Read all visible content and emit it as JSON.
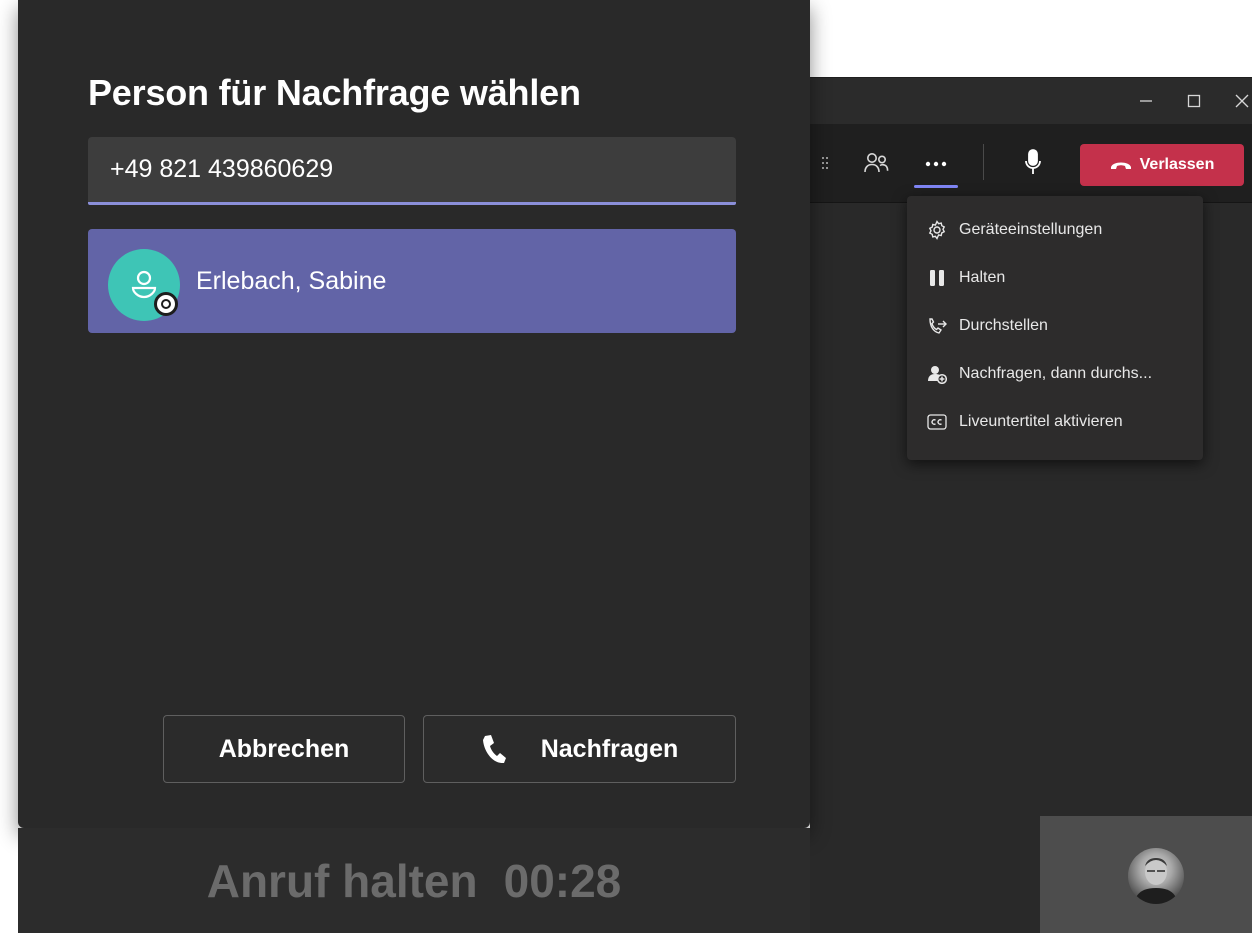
{
  "dialog": {
    "title": "Person für Nachfrage wählen",
    "search_value": "+49 821 439860629",
    "result": {
      "name": "Erlebach, Sabine",
      "presence": "offline"
    },
    "cancel_label": "Abbrechen",
    "consult_label": "Nachfragen"
  },
  "hold_status": {
    "label": "Anruf halten",
    "timer": "00:28"
  },
  "toolbar": {
    "leave_label": "Verlassen"
  },
  "more_menu": {
    "items": [
      {
        "label": "Geräteeinstellungen",
        "icon": "gear-icon"
      },
      {
        "label": "Halten",
        "icon": "pause-icon"
      },
      {
        "label": "Durchstellen",
        "icon": "transfer-icon"
      },
      {
        "label": "Nachfragen, dann durchs...",
        "icon": "consult-icon"
      },
      {
        "label": "Liveuntertitel aktivieren",
        "icon": "closed-captions-icon"
      }
    ]
  },
  "colors": {
    "accent": "#6264a7",
    "leave": "#c4314b",
    "avatar": "#3ec5b6",
    "input_underline": "#8b8fd9"
  }
}
